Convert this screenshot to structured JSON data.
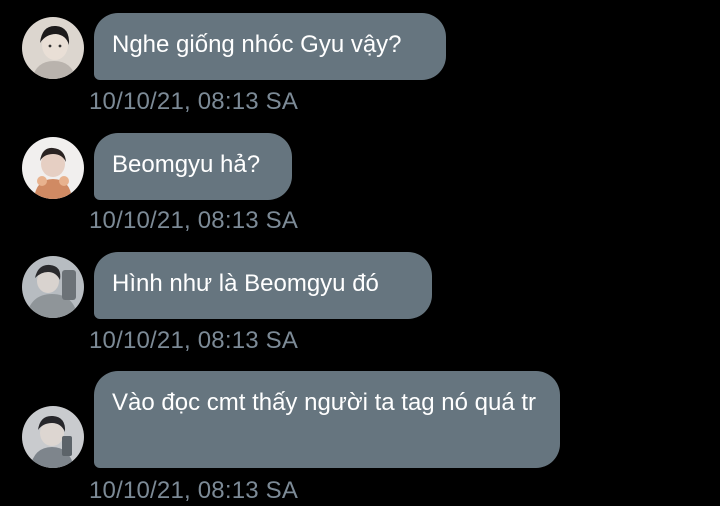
{
  "colors": {
    "background": "#000000",
    "bubble": "#66757f",
    "bubble_text": "#ffffff",
    "timestamp": "#7c8a96"
  },
  "messages": [
    {
      "avatar_icon": "user-avatar-1",
      "text": "Nghe giống nhóc Gyu vậy?",
      "timestamp": "10/10/21, 08:13 SA"
    },
    {
      "avatar_icon": "user-avatar-2",
      "text": "Beomgyu hả?",
      "timestamp": "10/10/21, 08:13 SA"
    },
    {
      "avatar_icon": "user-avatar-3",
      "text": "Hình như là Beomgyu đó",
      "timestamp": "10/10/21, 08:13 SA"
    },
    {
      "avatar_icon": "user-avatar-4",
      "text": "Vào đọc cmt thấy người ta tag nó quá tr",
      "timestamp": "10/10/21, 08:13 SA"
    }
  ]
}
